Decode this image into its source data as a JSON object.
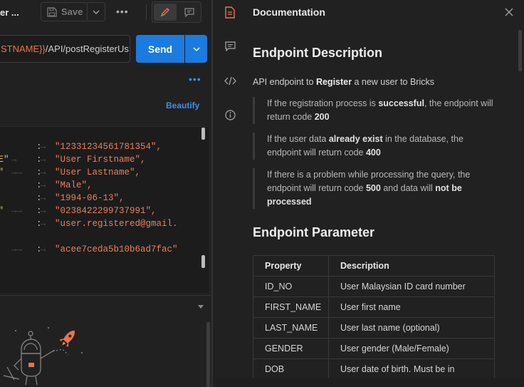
{
  "request": {
    "tab_title": "er ...",
    "save_label": "Save",
    "url_variable": "STNAME}}",
    "url_path": "/API/postRegisterUs",
    "send_label": "Send",
    "beautify_label": "Beautify"
  },
  "body_lines": [
    {
      "key": "",
      "value": "\"12331234561781354\","
    },
    {
      "key": "ME\"",
      "value": "\"User Firstname\","
    },
    {
      "key": "E\"",
      "value": "\"User Lastname\","
    },
    {
      "key": "",
      "value": "\"Male\","
    },
    {
      "key": "",
      "value": "\"1994-06-13\","
    },
    {
      "key": "O\"",
      "value": "\"0238422299737991\","
    },
    {
      "key": "",
      "value": "\"user.registered@gmail."
    },
    {
      "key": "",
      "value": ""
    },
    {
      "key": "\"",
      "value": "\"acee7ceda5b10b6ad7fac\""
    }
  ],
  "documentation": {
    "panel_title": "Documentation",
    "heading_description": "Endpoint Description",
    "intro_prefix": "API endpoint to ",
    "intro_bold": "Register",
    "intro_suffix": " a new user to Bricks",
    "notes": [
      {
        "pre": "If the registration process is ",
        "b1": "successful",
        "mid": ", the endpoint will return code ",
        "b2": "200",
        "post": ""
      },
      {
        "pre": "If the user data ",
        "b1": "already exist",
        "mid": " in the database, the endpoint will return code ",
        "b2": "400",
        "post": ""
      },
      {
        "pre": "If there is a problem while processing the query, the endpoint will return code ",
        "b1": "500",
        "mid": " and data will ",
        "b2": "not be processed",
        "post": ""
      }
    ],
    "heading_parameter": "Endpoint Parameter",
    "table_headers": [
      "Property",
      "Description"
    ],
    "table_rows": [
      [
        "ID_NO",
        "User Malaysian ID card number"
      ],
      [
        "FIRST_NAME",
        "User first name"
      ],
      [
        "LAST_NAME",
        "User last name (optional)"
      ],
      [
        "GENDER",
        "User gender (Male/Female)"
      ],
      [
        "DOB",
        "User date of birth. Must be in"
      ]
    ]
  },
  "colors": {
    "accent_blue": "#1a7be1",
    "variable_orange": "#e8754a",
    "active_icon_orange": "#e8754a"
  }
}
